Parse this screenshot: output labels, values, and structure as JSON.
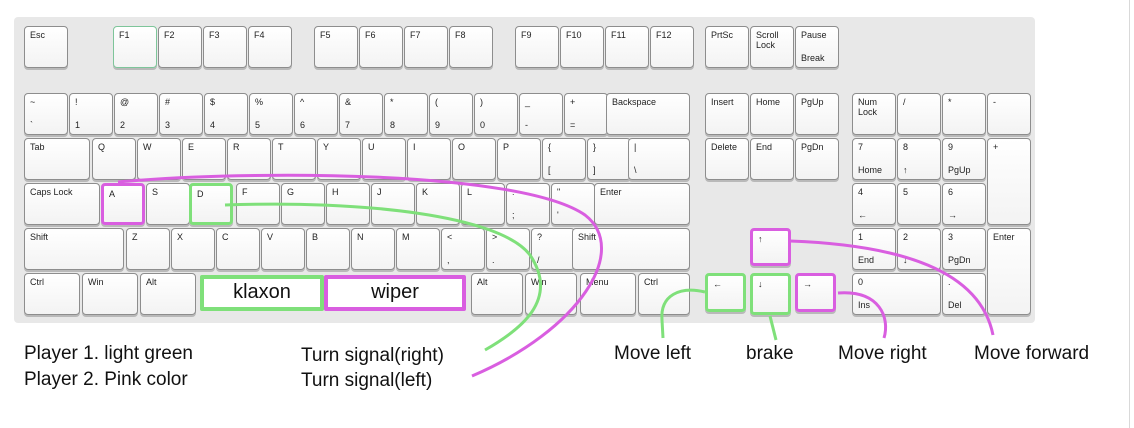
{
  "colors": {
    "player1": "#7fe07a",
    "player2": "#d95ee0"
  },
  "keys": {
    "esc": {
      "t": "Esc"
    },
    "f1": {
      "t": "F1"
    },
    "f2": {
      "t": "F2"
    },
    "f3": {
      "t": "F3"
    },
    "f4": {
      "t": "F4"
    },
    "f5": {
      "t": "F5"
    },
    "f6": {
      "t": "F6"
    },
    "f7": {
      "t": "F7"
    },
    "f8": {
      "t": "F8"
    },
    "f9": {
      "t": "F9"
    },
    "f10": {
      "t": "F10"
    },
    "f11": {
      "t": "F11"
    },
    "f12": {
      "t": "F12"
    },
    "prtsc": {
      "t": "PrtSc"
    },
    "scroll": {
      "t": "Scroll\nLock"
    },
    "pause": {
      "t": "Pause",
      "b": "Break"
    },
    "tilde": {
      "t": "~",
      "b": "`"
    },
    "k1": {
      "t": "!",
      "b": "1"
    },
    "k2": {
      "t": "@",
      "b": "2"
    },
    "k3": {
      "t": "#",
      "b": "3"
    },
    "k4": {
      "t": "$",
      "b": "4"
    },
    "k5": {
      "t": "%",
      "b": "5"
    },
    "k6": {
      "t": "^",
      "b": "6"
    },
    "k7": {
      "t": "&",
      "b": "7"
    },
    "k8": {
      "t": "*",
      "b": "8"
    },
    "k9": {
      "t": "(",
      "b": "9"
    },
    "k0": {
      "t": ")",
      "b": "0"
    },
    "minus": {
      "t": "_",
      "b": "-"
    },
    "equal": {
      "t": "+",
      "b": "="
    },
    "backspace": {
      "t": "Backspace"
    },
    "insert": {
      "t": "Insert"
    },
    "home": {
      "t": "Home"
    },
    "pgup": {
      "t": "PgUp"
    },
    "numlock": {
      "t": "Num\nLock"
    },
    "npslash": {
      "t": "/"
    },
    "npstar": {
      "t": "*"
    },
    "npminus": {
      "t": "-"
    },
    "tab": {
      "t": "Tab"
    },
    "q": {
      "t": "Q"
    },
    "w": {
      "t": "W"
    },
    "e": {
      "t": "E"
    },
    "r": {
      "t": "R"
    },
    "tkey": {
      "t": "T"
    },
    "y": {
      "t": "Y"
    },
    "u": {
      "t": "U"
    },
    "i": {
      "t": "I"
    },
    "o": {
      "t": "O"
    },
    "p": {
      "t": "P"
    },
    "lbracket": {
      "t": "{",
      "b": "["
    },
    "rbracket": {
      "t": "}",
      "b": "]"
    },
    "backslash": {
      "t": "|",
      "b": "\\"
    },
    "delete": {
      "t": "Delete"
    },
    "end": {
      "t": "End"
    },
    "pgdn": {
      "t": "PgDn"
    },
    "np7": {
      "t": "7",
      "b": "Home"
    },
    "np8": {
      "t": "8",
      "b": "↑"
    },
    "np9": {
      "t": "9",
      "b": "PgUp"
    },
    "npplus": {
      "t": "+"
    },
    "caps": {
      "t": "Caps Lock"
    },
    "a": {
      "t": "A"
    },
    "s": {
      "t": "S"
    },
    "d": {
      "t": "D"
    },
    "f": {
      "t": "F"
    },
    "g": {
      "t": "G"
    },
    "h": {
      "t": "H"
    },
    "j": {
      "t": "J"
    },
    "k": {
      "t": "K"
    },
    "l": {
      "t": "L"
    },
    "semicolon": {
      "t": ":",
      "b": ";"
    },
    "quote": {
      "t": "\"",
      "b": "'"
    },
    "enter": {
      "t": "Enter"
    },
    "np4": {
      "t": "4",
      "b": "←"
    },
    "np5": {
      "t": "5"
    },
    "np6": {
      "t": "6",
      "b": "→"
    },
    "lshift": {
      "t": "Shift"
    },
    "z": {
      "t": "Z"
    },
    "x": {
      "t": "X"
    },
    "c": {
      "t": "C"
    },
    "v": {
      "t": "V"
    },
    "bkey": {
      "t": "B"
    },
    "n": {
      "t": "N"
    },
    "m": {
      "t": "M"
    },
    "comma": {
      "t": "<",
      "b": ","
    },
    "period": {
      "t": ">",
      "b": "."
    },
    "slash": {
      "t": "?",
      "b": "/"
    },
    "rshift": {
      "t": "Shift"
    },
    "up": {
      "t": "↑"
    },
    "np1": {
      "t": "1",
      "b": "End"
    },
    "np2": {
      "t": "2",
      "b": "↓"
    },
    "np3": {
      "t": "3",
      "b": "PgDn"
    },
    "npenter": {
      "t": "Enter"
    },
    "lctrl": {
      "t": "Ctrl"
    },
    "lwin": {
      "t": "Win"
    },
    "lalt": {
      "t": "Alt"
    },
    "ralt": {
      "t": "Alt"
    },
    "rwin": {
      "t": "Win"
    },
    "menu": {
      "t": "Menu"
    },
    "rctrl": {
      "t": "Ctrl"
    },
    "left": {
      "t": "←"
    },
    "down": {
      "t": "↓"
    },
    "right": {
      "t": "→"
    },
    "np0": {
      "t": "0",
      "b": "Ins"
    },
    "npdot": {
      "t": ".",
      "b": "Del"
    }
  },
  "space_labels": {
    "klaxon": "klaxon",
    "wiper": "wiper"
  },
  "legend": {
    "player1": "Player 1. light green",
    "player2": "Player 2. Pink color"
  },
  "annotations": {
    "turn_right": "Turn signal(right)",
    "turn_left": "Turn signal(left)",
    "move_left": "Move left",
    "brake": "brake",
    "move_right": "Move right",
    "move_forward": "Move forward"
  }
}
